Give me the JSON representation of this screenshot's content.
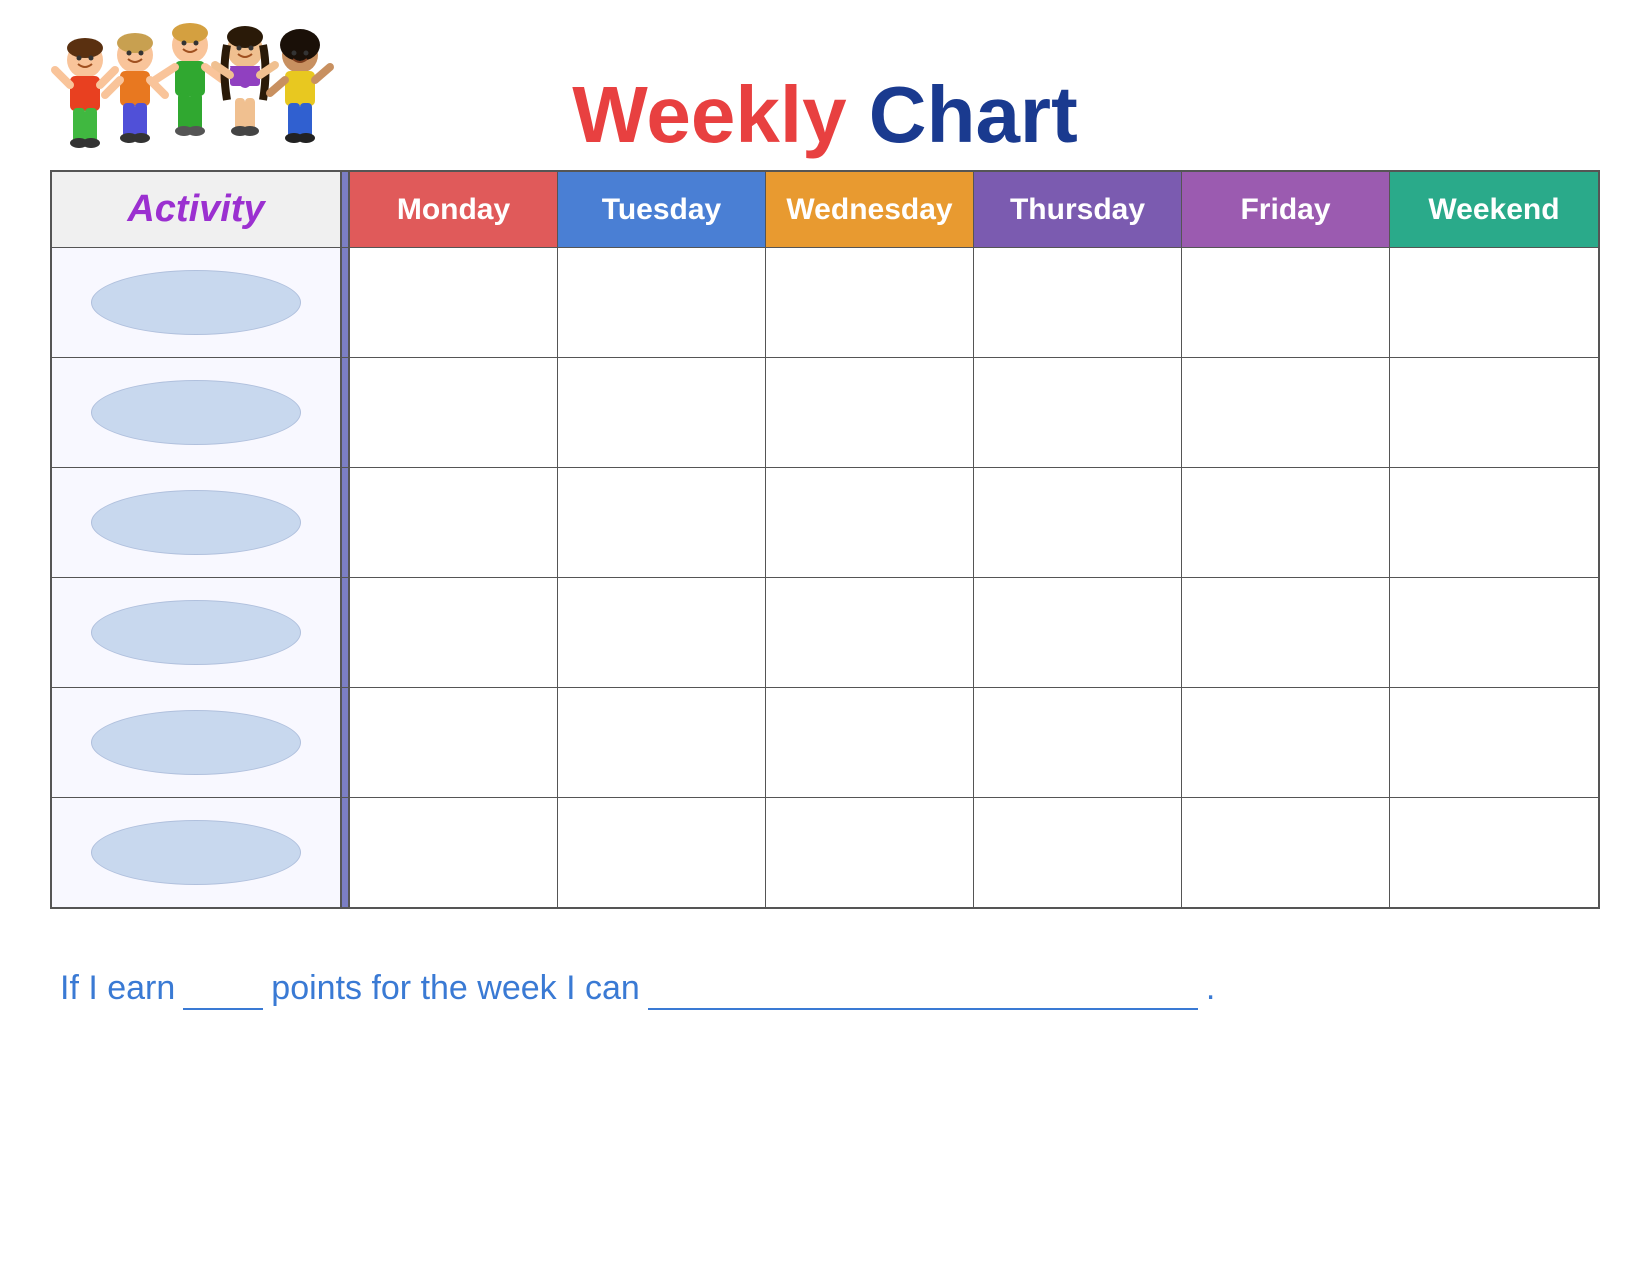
{
  "title": {
    "weekly": "Weekly",
    "chart": "Chart"
  },
  "activity_label": "Activity",
  "days": [
    {
      "label": "Monday",
      "class": "monday"
    },
    {
      "label": "Tuesday",
      "class": "tuesday"
    },
    {
      "label": "Wednesday",
      "class": "wednesday"
    },
    {
      "label": "Thursday",
      "class": "thursday"
    },
    {
      "label": "Friday",
      "class": "friday"
    },
    {
      "label": "Weekend",
      "class": "weekend"
    }
  ],
  "rows": 6,
  "footer": {
    "text1": "If I earn",
    "blank1": "",
    "text2": "points for the week I can",
    "blank2": "",
    "period": "."
  }
}
